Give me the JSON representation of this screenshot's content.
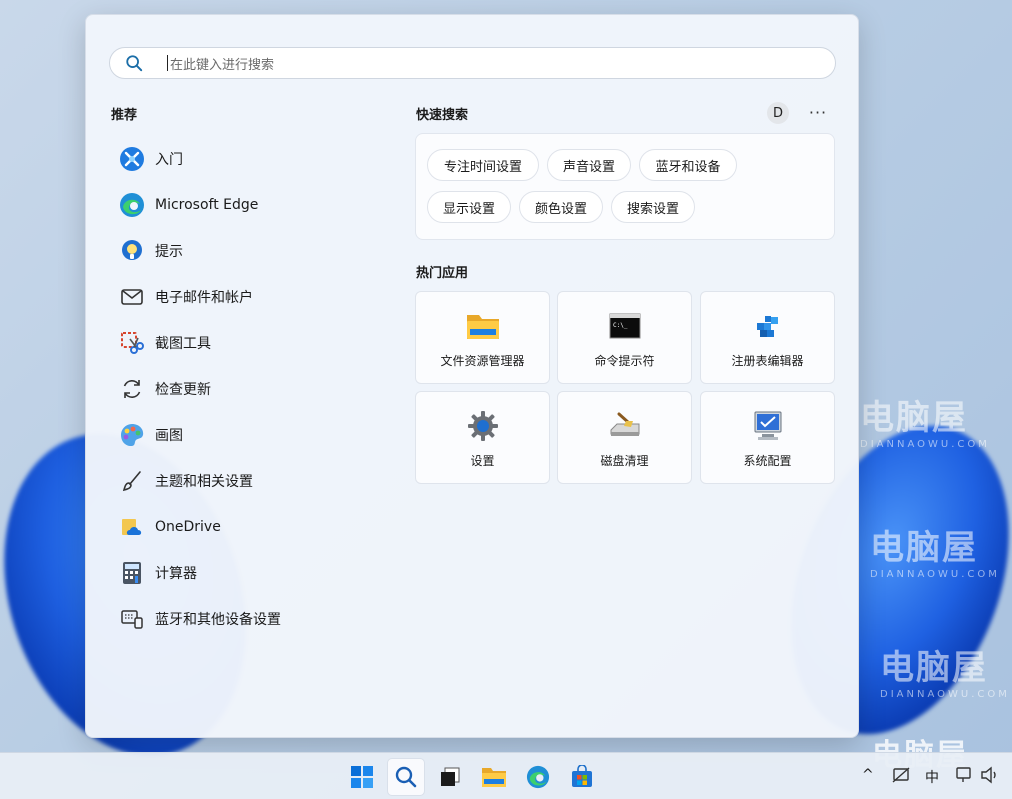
{
  "search": {
    "placeholder": "在此键入进行搜索"
  },
  "recommended": {
    "title": "推荐",
    "items": [
      {
        "label": "入门",
        "icon": "get-started-icon"
      },
      {
        "label": "Microsoft Edge",
        "icon": "edge-icon"
      },
      {
        "label": "提示",
        "icon": "tips-icon"
      },
      {
        "label": "电子邮件和帐户",
        "icon": "mail-icon"
      },
      {
        "label": "截图工具",
        "icon": "snipping-tool-icon"
      },
      {
        "label": "检查更新",
        "icon": "refresh-icon"
      },
      {
        "label": "画图",
        "icon": "paint-icon"
      },
      {
        "label": "主题和相关设置",
        "icon": "brush-icon"
      },
      {
        "label": "OneDrive",
        "icon": "onedrive-icon"
      },
      {
        "label": "计算器",
        "icon": "calculator-icon"
      },
      {
        "label": "蓝牙和其他设备设置",
        "icon": "devices-icon"
      }
    ]
  },
  "quick_search": {
    "title": "快速搜索",
    "avatar_letter": "D",
    "more": "···",
    "chips": [
      "专注时间设置",
      "声音设置",
      "蓝牙和设备",
      "显示设置",
      "颜色设置",
      "搜索设置"
    ]
  },
  "top_apps": {
    "title": "热门应用",
    "apps": [
      {
        "label": "文件资源管理器",
        "icon": "folder-icon"
      },
      {
        "label": "命令提示符",
        "icon": "cmd-icon"
      },
      {
        "label": "注册表编辑器",
        "icon": "regedit-icon"
      },
      {
        "label": "设置",
        "icon": "settings-gear-icon"
      },
      {
        "label": "磁盘清理",
        "icon": "disk-cleanup-icon"
      },
      {
        "label": "系统配置",
        "icon": "system-config-icon"
      }
    ]
  },
  "taskbar": {
    "ime": "中",
    "tray_chevron": "^",
    "watermark_text": "电脑屋"
  },
  "watermark": {
    "text": "电脑屋",
    "sub": "DIANNAOWU.COM"
  },
  "colors": {
    "accent": "#0067c0",
    "panel": "#f1f5fb",
    "wallpaper_blue": "#1e5fe0"
  }
}
